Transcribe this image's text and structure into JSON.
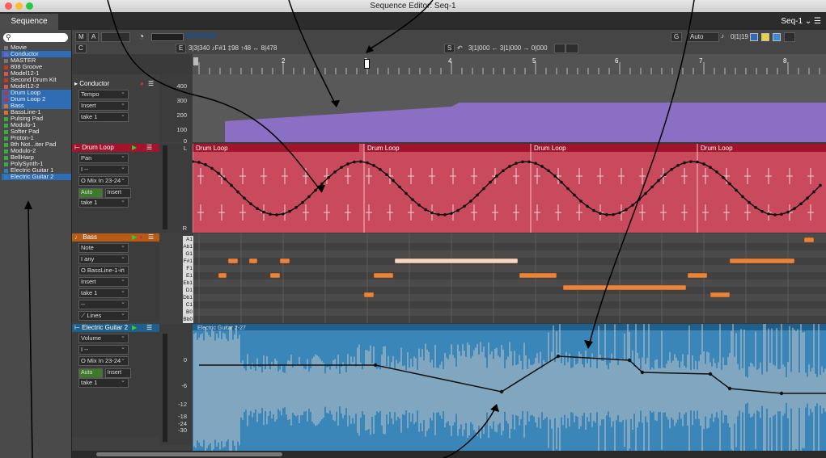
{
  "window": {
    "title": "Sequence Editor: Seq-1",
    "tab_label": "Sequence Editor",
    "sequence_selector": "Seq-1"
  },
  "toolbar": {
    "btn_m": "M",
    "btn_a": "A",
    "btn_c": "C",
    "btn_e": "E",
    "readout": "3|3|340  ♪F#1  ‡98  ↑48  ↔  8|478",
    "btn_s": "S",
    "range": "3|1|000 ← 3|1|000 → 0|000",
    "btn_g": "G",
    "auto_label": "Auto",
    "grid_value": "0|1|19"
  },
  "ruler": {
    "bars": [
      "2",
      "3",
      "4",
      "5",
      "6",
      "7",
      "8"
    ]
  },
  "sidebar": {
    "items": [
      {
        "label": "Movie",
        "color": "#7a7a7a",
        "selected": false
      },
      {
        "label": "Conductor",
        "color": "#7e5fc9",
        "selected": true
      },
      {
        "label": "MASTER",
        "color": "#777777",
        "selected": false
      },
      {
        "label": "808 Groove",
        "color": "#c0392b",
        "selected": false
      },
      {
        "label": "Model12-1",
        "color": "#d4574a",
        "selected": false
      },
      {
        "label": "Second Drum Kit",
        "color": "#c0392b",
        "selected": false
      },
      {
        "label": "Model12-2",
        "color": "#d4574a",
        "selected": false
      },
      {
        "label": "Drum Loop",
        "color": "#c23045",
        "selected": true
      },
      {
        "label": "Drum Loop 2",
        "color": "#c23045",
        "selected": true
      },
      {
        "label": "Bass",
        "color": "#e07020",
        "selected": true
      },
      {
        "label": "BassLine-1",
        "color": "#e07020",
        "selected": false
      },
      {
        "label": "Pulsing Pad",
        "color": "#3fa64a",
        "selected": false
      },
      {
        "label": "Modulo-1",
        "color": "#3fa64a",
        "selected": false
      },
      {
        "label": "Softer Pad",
        "color": "#3fa64a",
        "selected": false
      },
      {
        "label": "Proton-1",
        "color": "#3fa64a",
        "selected": false
      },
      {
        "label": "8th Not...iter Pad",
        "color": "#3fa64a",
        "selected": false
      },
      {
        "label": "Modulo-2",
        "color": "#3fa64a",
        "selected": false
      },
      {
        "label": "BellHarp",
        "color": "#3fa64a",
        "selected": false
      },
      {
        "label": "PolySynth-1",
        "color": "#3fa64a",
        "selected": false
      },
      {
        "label": "Electric Guitar 1",
        "color": "#2d7dbf",
        "selected": false
      },
      {
        "label": "Electric Guitar 2",
        "color": "#2d7dbf",
        "selected": true
      }
    ]
  },
  "tracks": {
    "conductor": {
      "title": "Conductor",
      "param": "Tempo",
      "mode": "Insert",
      "take": "take 1",
      "scale": [
        "400",
        "300",
        "200",
        "100",
        "0"
      ]
    },
    "drum_loop": {
      "title": "Drum Loop",
      "param": "Pan",
      "value": "I --",
      "route": "O Mix In 23-24",
      "auto": "Auto",
      "mode": "Insert",
      "take": "take 1",
      "scale_top": "L",
      "scale_bottom": "R",
      "clip_labels": [
        "Drum Loop",
        "Drum Loop",
        "Drum Loop",
        "Drum Loop"
      ]
    },
    "bass": {
      "title": "Bass",
      "param": "Note",
      "value": "I any",
      "route": "O BassLine-1-in",
      "mode": "Insert",
      "take": "take 1",
      "extra": "--",
      "lines": "Lines",
      "keys": [
        "A1",
        "Ab1",
        "G1",
        "F#1",
        "F1",
        "E1",
        "Eb1",
        "D1",
        "Db1",
        "C1",
        "B0",
        "Bb0"
      ]
    },
    "guitar": {
      "title": "Electric Guitar 2",
      "param": "Volume",
      "value": "I --",
      "route": "O Mix In 23-24",
      "auto": "Auto",
      "mode": "Insert",
      "take": "take 1",
      "clip_label": "Electric Guitar 2-27",
      "scale": [
        "0",
        "-6",
        "-12",
        "-18",
        "-24",
        "-30"
      ]
    }
  },
  "colors": {
    "conductor_fill": "#8b6fc4",
    "drum_lane": "#c94a5c",
    "drum_header": "#a0152b",
    "bass_note": "#e8853a",
    "guitar_lane": "#3a86b8",
    "guitar_header": "#1f5f8c"
  }
}
